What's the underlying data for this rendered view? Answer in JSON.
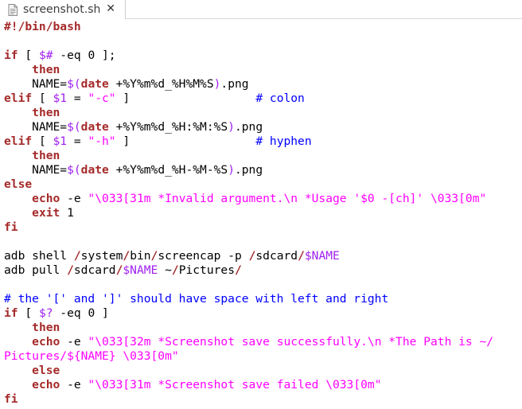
{
  "tab": {
    "title": "screenshot.sh",
    "close_symbol": "✕",
    "icon": "document-icon"
  },
  "colors": {
    "keyword": "#a52a2a",
    "variable": "#a020f0",
    "string": "#ff00ff",
    "comment": "#0000ff",
    "text": "#000000"
  },
  "code": [
    [
      [
        "k",
        "#!/bin/bash"
      ]
    ],
    [],
    [
      [
        "k",
        "if"
      ],
      [
        "t",
        " [ "
      ],
      [
        "v",
        "$#"
      ],
      [
        "t",
        " -eq 0 ];"
      ]
    ],
    [
      [
        "t",
        "    "
      ],
      [
        "k",
        "then"
      ]
    ],
    [
      [
        "t",
        "    NAME="
      ],
      [
        "v",
        "$("
      ],
      [
        "k",
        "date"
      ],
      [
        "t",
        " +%Y%m%d_%H%M%S"
      ],
      [
        "v",
        ")"
      ],
      [
        "t",
        ".png"
      ]
    ],
    [
      [
        "k",
        "elif"
      ],
      [
        "t",
        " [ "
      ],
      [
        "v",
        "$1"
      ],
      [
        "t",
        " = "
      ],
      [
        "s",
        "\"-c\""
      ],
      [
        "t",
        " ]                  "
      ],
      [
        "c",
        "# colon"
      ]
    ],
    [
      [
        "t",
        "    "
      ],
      [
        "k",
        "then"
      ]
    ],
    [
      [
        "t",
        "    NAME="
      ],
      [
        "v",
        "$("
      ],
      [
        "k",
        "date"
      ],
      [
        "t",
        " +%Y%m%d_%H:%M:%S"
      ],
      [
        "v",
        ")"
      ],
      [
        "t",
        ".png"
      ]
    ],
    [
      [
        "k",
        "elif"
      ],
      [
        "t",
        " [ "
      ],
      [
        "v",
        "$1"
      ],
      [
        "t",
        " = "
      ],
      [
        "s",
        "\"-h\""
      ],
      [
        "t",
        " ]                  "
      ],
      [
        "c",
        "# hyphen"
      ]
    ],
    [
      [
        "t",
        "    "
      ],
      [
        "k",
        "then"
      ]
    ],
    [
      [
        "t",
        "    NAME="
      ],
      [
        "v",
        "$("
      ],
      [
        "k",
        "date"
      ],
      [
        "t",
        " +%Y%m%d_%H-%M-%S"
      ],
      [
        "v",
        ")"
      ],
      [
        "t",
        ".png"
      ]
    ],
    [
      [
        "k",
        "else"
      ]
    ],
    [
      [
        "t",
        "    "
      ],
      [
        "k",
        "echo"
      ],
      [
        "t",
        " -e "
      ],
      [
        "s",
        "\"\\033[31m *Invalid argument.\\n *Usage '$0 -[ch]' \\033[0m\""
      ]
    ],
    [
      [
        "t",
        "    "
      ],
      [
        "k",
        "exit"
      ],
      [
        "t",
        " 1"
      ]
    ],
    [
      [
        "k",
        "fi"
      ]
    ],
    [],
    [
      [
        "t",
        "adb shell "
      ],
      [
        "k",
        "/"
      ],
      [
        "t",
        "system"
      ],
      [
        "k",
        "/"
      ],
      [
        "t",
        "bin"
      ],
      [
        "k",
        "/"
      ],
      [
        "t",
        "screencap -p "
      ],
      [
        "k",
        "/"
      ],
      [
        "t",
        "sdcard"
      ],
      [
        "k",
        "/"
      ],
      [
        "v",
        "$NAME"
      ]
    ],
    [
      [
        "t",
        "adb pull "
      ],
      [
        "k",
        "/"
      ],
      [
        "t",
        "sdcard"
      ],
      [
        "k",
        "/"
      ],
      [
        "v",
        "$NAME"
      ],
      [
        "t",
        " ~"
      ],
      [
        "k",
        "/"
      ],
      [
        "t",
        "Pictures"
      ],
      [
        "k",
        "/"
      ]
    ],
    [],
    [
      [
        "c",
        "# the '[' and ']' should have space with left and right"
      ]
    ],
    [
      [
        "k",
        "if"
      ],
      [
        "t",
        " [ "
      ],
      [
        "v",
        "$?"
      ],
      [
        "t",
        " -eq 0 ]"
      ]
    ],
    [
      [
        "t",
        "    "
      ],
      [
        "k",
        "then"
      ]
    ],
    [
      [
        "t",
        "    "
      ],
      [
        "k",
        "echo"
      ],
      [
        "t",
        " -e "
      ],
      [
        "s",
        "\"\\033[32m *Screenshot save successfully.\\n *The Path is ~/"
      ]
    ],
    [
      [
        "s",
        "Pictures/${NAME} \\033[0m\""
      ]
    ],
    [
      [
        "t",
        "    "
      ],
      [
        "k",
        "else"
      ]
    ],
    [
      [
        "t",
        "    "
      ],
      [
        "k",
        "echo"
      ],
      [
        "t",
        " -e "
      ],
      [
        "s",
        "\"\\033[31m *Screenshot save failed \\033[0m\""
      ]
    ],
    [
      [
        "k",
        "fi"
      ]
    ]
  ]
}
